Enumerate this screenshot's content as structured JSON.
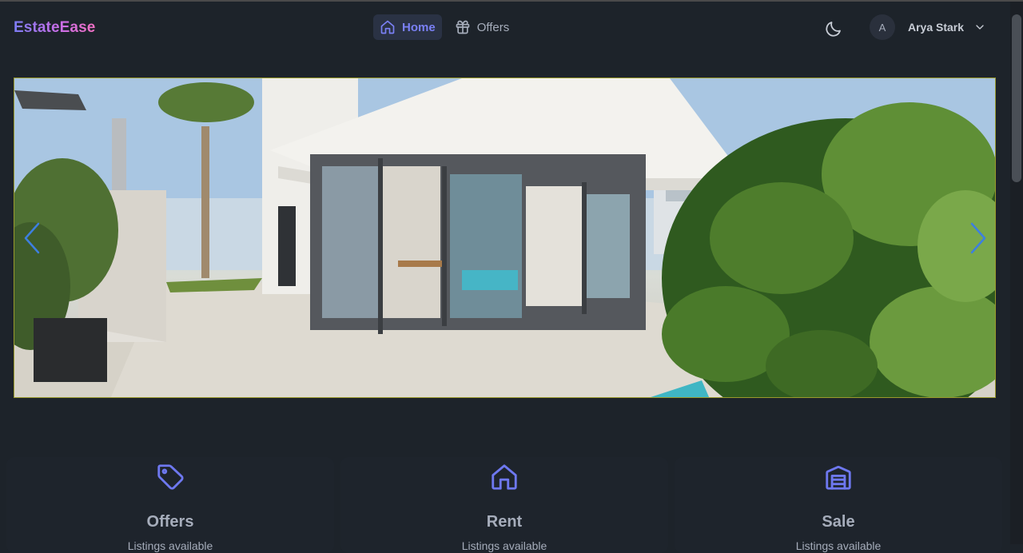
{
  "brand": {
    "name": "EstateEase"
  },
  "nav": {
    "home_label": "Home",
    "offers_label": "Offers"
  },
  "user": {
    "initial": "A",
    "name": "Arya Stark"
  },
  "features": [
    {
      "title": "Offers",
      "subtitle": "Listings available"
    },
    {
      "title": "Rent",
      "subtitle": "Listings available"
    },
    {
      "title": "Sale",
      "subtitle": "Listings available"
    }
  ],
  "colors": {
    "background": "#1d232a",
    "accent": "#7a80f5",
    "active_nav_bg": "#2a3244",
    "carousel_arrow": "#3d7fe0"
  },
  "icons": {
    "home": "home-icon",
    "offers": "gift-icon",
    "theme": "moon-icon",
    "user_menu": "chevron-down-icon",
    "carousel_prev": "chevron-left-icon",
    "carousel_next": "chevron-right-icon",
    "card_offers": "tag-icon",
    "card_rent": "home-icon",
    "card_sale": "warehouse-icon"
  }
}
